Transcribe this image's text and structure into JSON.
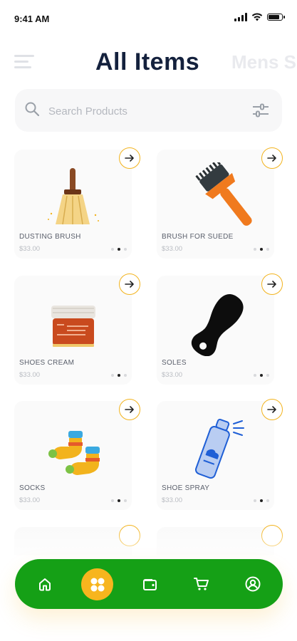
{
  "status_bar": {
    "time": "9:41 AM"
  },
  "header": {
    "title": "All Items",
    "next_category": "Mens S",
    "menu_icon": "hamburger-menu-icon"
  },
  "search": {
    "placeholder": "Search Products",
    "search_icon": "search-icon",
    "filter_icon": "filter-sliders-icon"
  },
  "colors": {
    "accent_yellow": "#f7b51e",
    "nav_green": "#15a016",
    "title_navy": "#14213d"
  },
  "products": [
    {
      "name": "DUSTING BRUSH",
      "price": "$33.00",
      "image": "dusting-brush"
    },
    {
      "name": "BRUSH FOR SUEDE",
      "price": "$33.00",
      "image": "suede-brush"
    },
    {
      "name": "SHOES CREAM",
      "price": "$33.00",
      "image": "shoe-cream-jar"
    },
    {
      "name": "SOLES",
      "price": "$33.00",
      "image": "shoe-sole"
    },
    {
      "name": "SOCKS",
      "price": "$33.00",
      "image": "socks"
    },
    {
      "name": "SHOE SPRAY",
      "price": "$33.00",
      "image": "shoe-spray"
    }
  ],
  "bottom_nav": {
    "items": [
      {
        "icon": "home-icon"
      },
      {
        "icon": "grid-icon",
        "active": true
      },
      {
        "icon": "wallet-icon"
      },
      {
        "icon": "cart-icon"
      },
      {
        "icon": "profile-icon"
      }
    ]
  }
}
